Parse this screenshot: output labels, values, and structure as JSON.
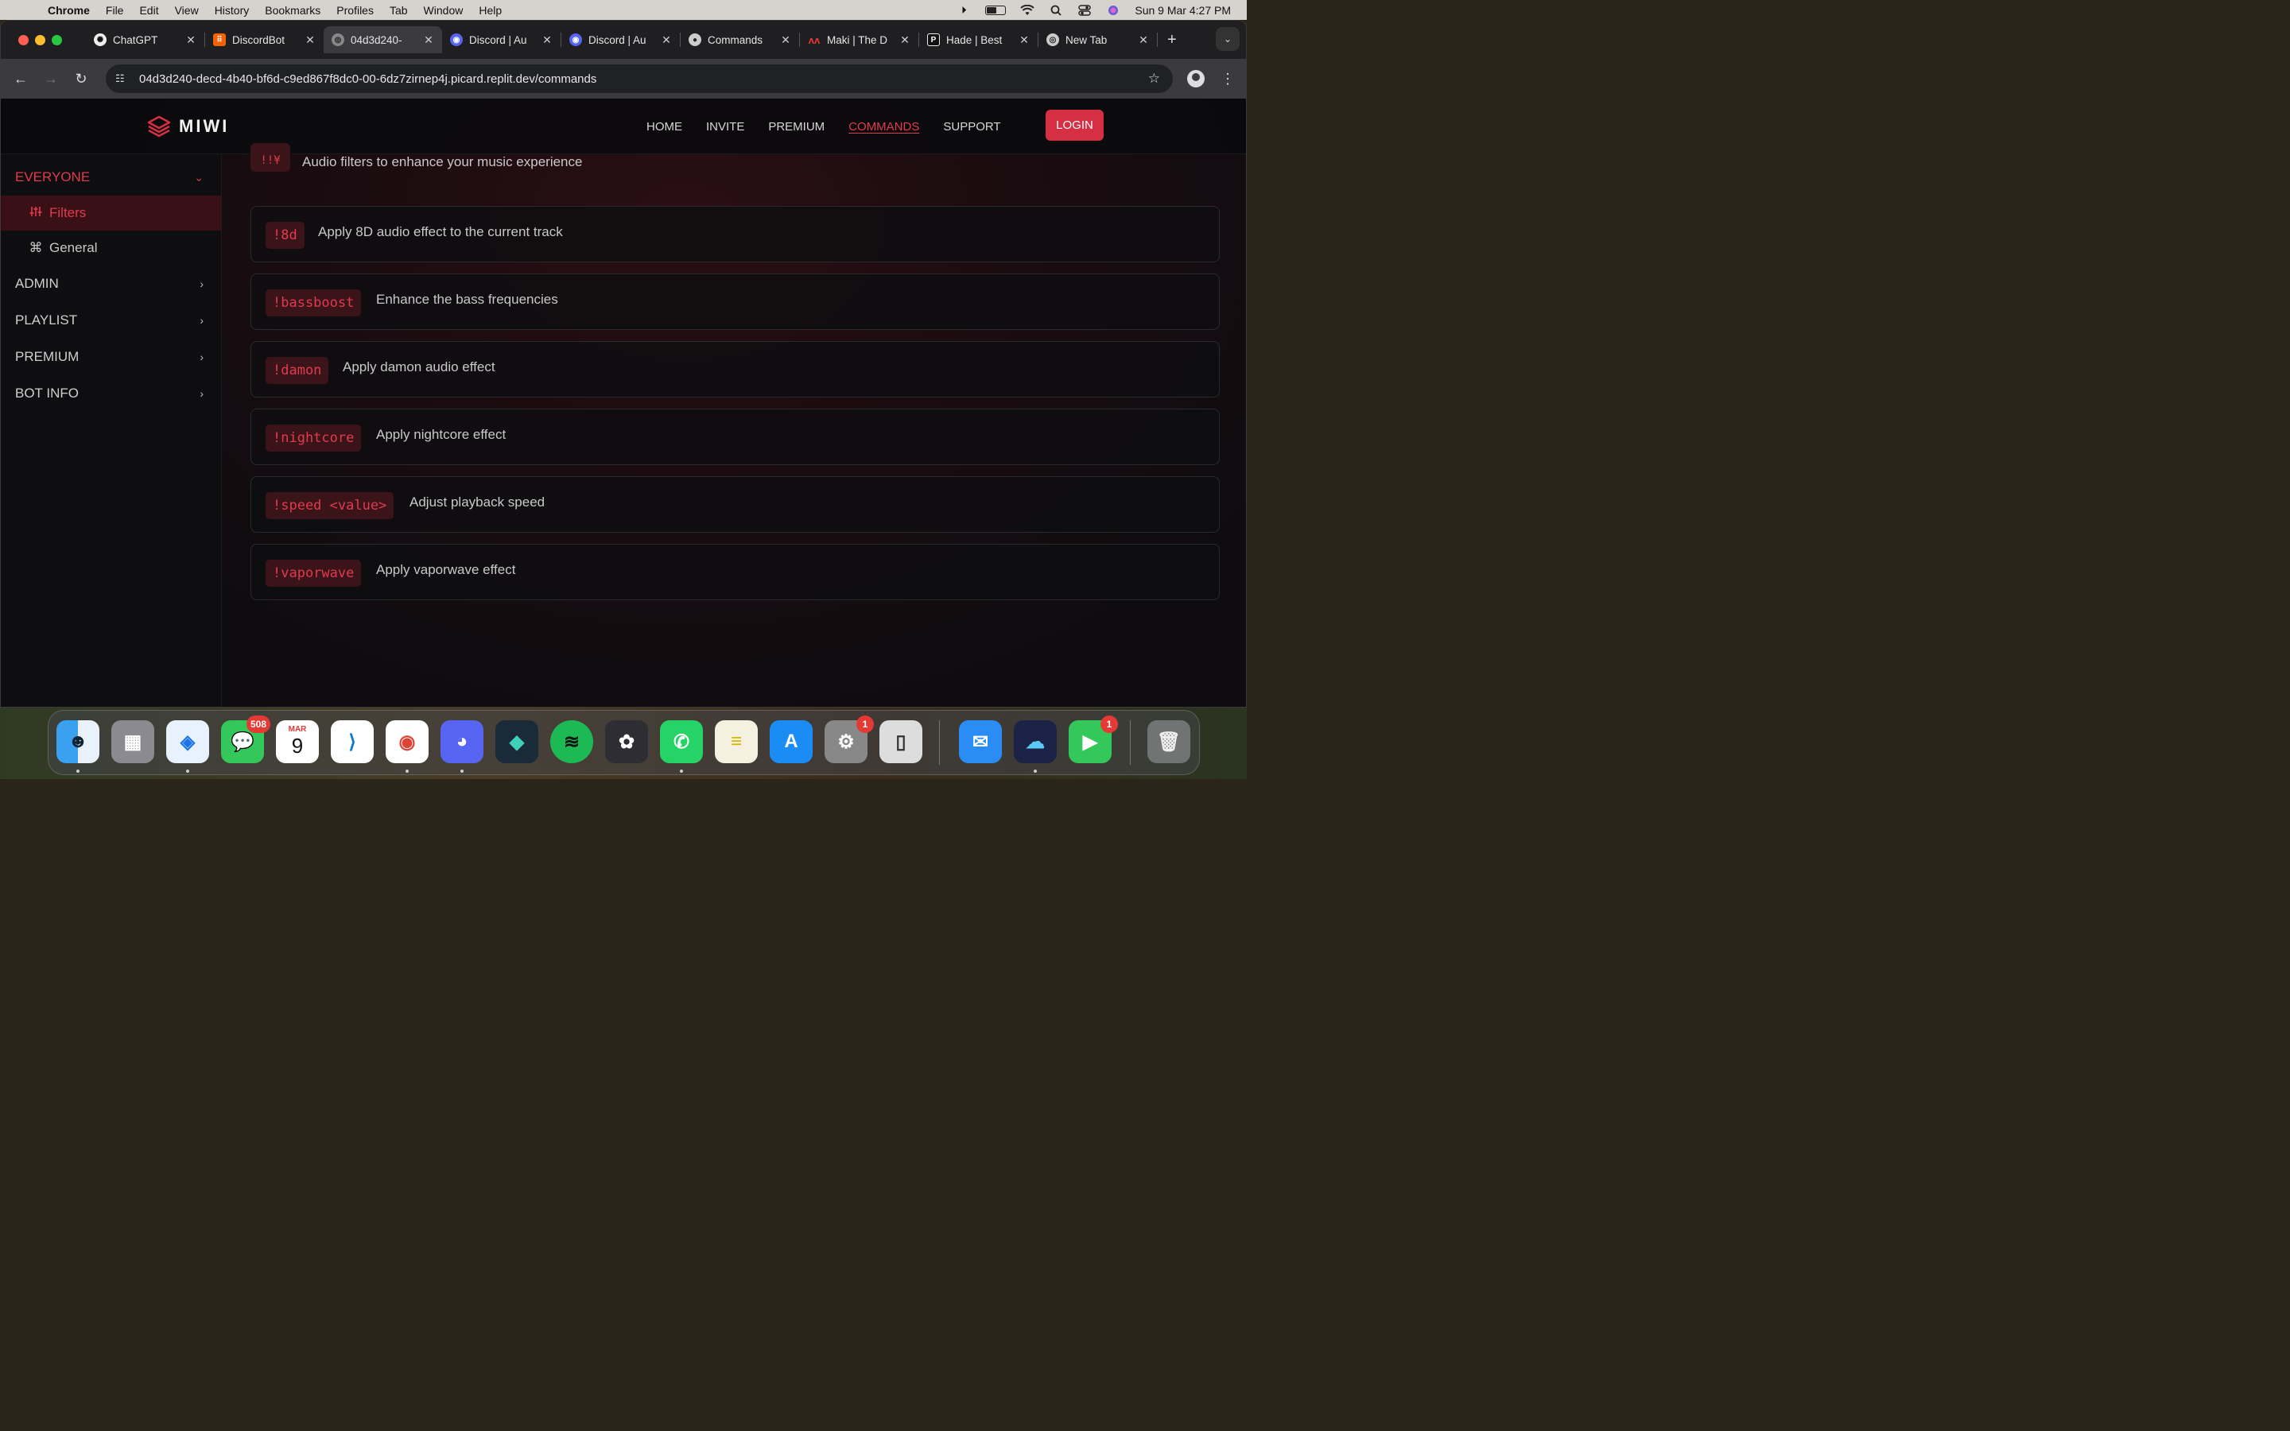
{
  "menubar": {
    "app": "Chrome",
    "items": [
      "File",
      "Edit",
      "View",
      "History",
      "Bookmarks",
      "Profiles",
      "Tab",
      "Window",
      "Help"
    ],
    "datetime": "Sun 9 Mar  4:27 PM"
  },
  "browser": {
    "tabs": [
      {
        "title": "ChatGPT",
        "active": false
      },
      {
        "title": "DiscordBot",
        "active": false
      },
      {
        "title": "04d3d240-",
        "active": true
      },
      {
        "title": "Discord | Au",
        "active": false
      },
      {
        "title": "Discord | Au",
        "active": false
      },
      {
        "title": "Commands",
        "active": false
      },
      {
        "title": "Maki | The D",
        "active": false
      },
      {
        "title": "Hade | Best",
        "active": false
      },
      {
        "title": "New Tab",
        "active": false
      }
    ],
    "url": "04d3d240-decd-4b40-bf6d-c9ed867f8dc0-00-6dz7zirnep4j.picard.replit.dev/commands"
  },
  "site": {
    "logo_text": "MIWI",
    "nav": {
      "home": "HOME",
      "invite": "INVITE",
      "premium": "PREMIUM",
      "commands": "COMMANDS",
      "support": "SUPPORT"
    },
    "login": "LOGIN",
    "accent": "#d62f44"
  },
  "sidebar": {
    "categories": [
      {
        "label": "EVERYONE",
        "open": true
      },
      {
        "label": "ADMIN"
      },
      {
        "label": "PLAYLIST"
      },
      {
        "label": "PREMIUM"
      },
      {
        "label": "BOT INFO"
      }
    ],
    "subitems": [
      {
        "label": "Filters",
        "active": true,
        "icon": "sliders-icon"
      },
      {
        "label": "General",
        "active": false,
        "icon": "command-icon"
      }
    ]
  },
  "section": {
    "badge": "!!¥",
    "description": "Audio filters to enhance your music experience"
  },
  "commands": [
    {
      "code": "!8d",
      "desc": "Apply 8D audio effect to the current track"
    },
    {
      "code": "!bassboost",
      "desc": "Enhance the bass frequencies"
    },
    {
      "code": "!damon",
      "desc": "Apply damon audio effect"
    },
    {
      "code": "!nightcore",
      "desc": "Apply nightcore effect"
    },
    {
      "code": "!speed <value>",
      "desc": "Adjust playback speed"
    },
    {
      "code": "!vaporwave",
      "desc": "Apply vaporwave effect"
    }
  ],
  "dock": {
    "messages_badge": "508",
    "calendar_month": "MAR",
    "calendar_day": "9",
    "settings_badge": "1",
    "facetime_badge": "1"
  }
}
